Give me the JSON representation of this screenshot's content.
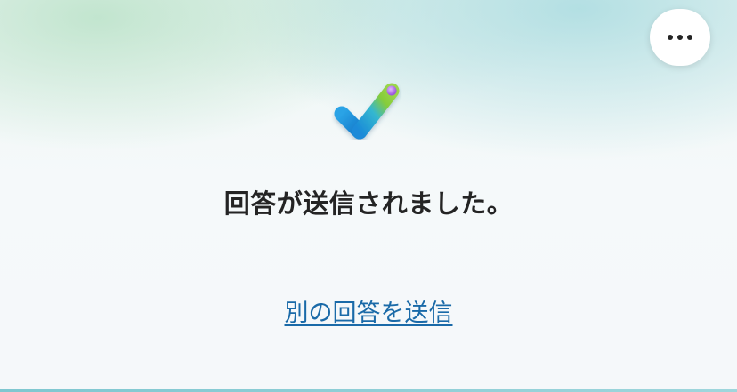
{
  "header": {
    "more_icon": "more-horizontal-icon"
  },
  "confirmation": {
    "icon": "checkmark-icon",
    "title": "回答が送信されました。",
    "submit_another_label": "別の回答を送信"
  },
  "colors": {
    "link": "#1a6aa8",
    "title": "#242424",
    "check_blue": "#1e8fdc",
    "check_green": "#8ccf3c",
    "check_dot": "#b678e8"
  }
}
